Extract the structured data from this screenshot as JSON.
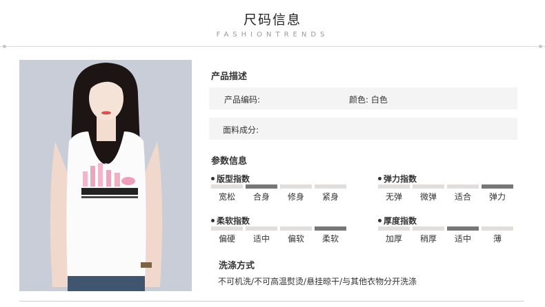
{
  "header": {
    "title": "尺码信息",
    "subtitle": "FASHIONTRENDS"
  },
  "product": {
    "photo_alt": "model in white sleeveless top"
  },
  "description": {
    "heading": "产品描述",
    "code_label": "产品编码:",
    "color_label": "颜色: 白色",
    "fabric_label": "面料成分:"
  },
  "params": {
    "heading": "参数信息",
    "groups": [
      {
        "title": "版型指数",
        "labels": [
          "宽松",
          "合身",
          "修身",
          "紧身"
        ],
        "selected_index": 1
      },
      {
        "title": "弹力指数",
        "labels": [
          "无弹",
          "微弹",
          "适合",
          "弹力"
        ],
        "selected_index": 3
      },
      {
        "title": "柔软指数",
        "labels": [
          "偏硬",
          "适中",
          "偏软",
          "柔软"
        ],
        "selected_index": 3
      },
      {
        "title": "厚度指数",
        "labels": [
          "加厚",
          "稍厚",
          "适中",
          "薄"
        ],
        "selected_index": 2
      }
    ]
  },
  "wash": {
    "heading": "洗涤方式",
    "text": "不可机洗/不可高温熨烫/悬挂晾干/与其他衣物分开洗涤"
  },
  "colors": {
    "bar_active": "#777777",
    "bar_inactive": "#e1dedb",
    "row_bg": "#f4f4f4"
  }
}
